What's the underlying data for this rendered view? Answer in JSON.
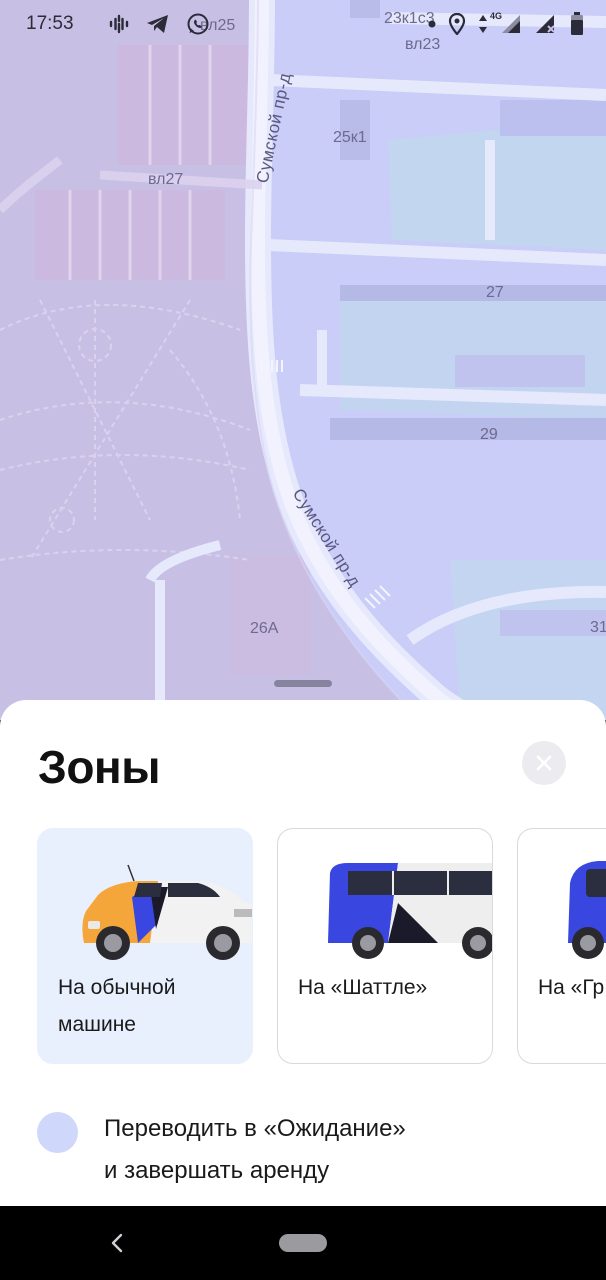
{
  "status_bar": {
    "time": "17:53",
    "network": "4G",
    "icons": [
      "podcast-icon",
      "telegram-icon",
      "whatsapp-icon",
      "location-icon",
      "data-arrows-icon",
      "signal-icon",
      "signal-nosim-icon",
      "battery-icon"
    ]
  },
  "map": {
    "labels": {
      "vl25": "вл25",
      "b23k1s3": "23к1с3",
      "vl23": "вл23",
      "b25k1": "25к1",
      "vl27": "вл27",
      "b27": "27",
      "b29": "29",
      "b26a": "26А",
      "b31": "31"
    },
    "streets": {
      "top": "Сумской пр-д",
      "bottom": "Сумской пр-д"
    },
    "colors": {
      "zone_purple": "#c7c0e4",
      "zone_blue": "#c9cdf7",
      "road": "#e4e6fb",
      "green_area": "#c1dceb"
    }
  },
  "sheet": {
    "title": "Зоны",
    "close_label": "close",
    "cards": [
      {
        "label": "На обычной машине",
        "selected": true
      },
      {
        "label": "На «Шаттле»",
        "selected": false
      },
      {
        "label": "На «Гр",
        "selected": false
      }
    ],
    "option": {
      "text_line1": "Переводить в «Ожидание»",
      "text_line2": "и завершать аренду",
      "dot_color": "#cfd8fb"
    }
  },
  "colors": {
    "brand_blue": "#3a46e0",
    "brand_orange": "#f5a63a",
    "selected_card_bg": "#e8effd"
  }
}
